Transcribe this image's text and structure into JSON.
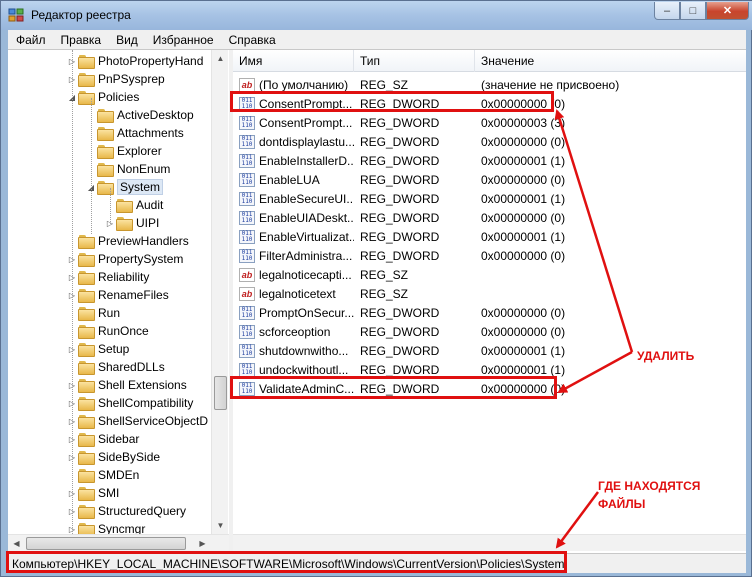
{
  "window": {
    "title": "Редактор реестра",
    "minimize_glyph": "–",
    "maximize_glyph": "□",
    "close_glyph": "✕"
  },
  "menu": [
    "Файл",
    "Правка",
    "Вид",
    "Избранное",
    "Справка"
  ],
  "tree": {
    "items": [
      {
        "label": "PhotoPropertyHand",
        "expander": "▷",
        "selected": false
      },
      {
        "label": "PnPSysprep",
        "expander": "▷",
        "selected": false
      },
      {
        "label": "Policies",
        "expander": "◢",
        "selected": false
      },
      {
        "label": "ActiveDesktop",
        "expander": "",
        "selected": false
      },
      {
        "label": "Attachments",
        "expander": "",
        "selected": false
      },
      {
        "label": "Explorer",
        "expander": "",
        "selected": false
      },
      {
        "label": "NonEnum",
        "expander": "",
        "selected": false
      },
      {
        "label": "System",
        "expander": "◢",
        "selected": true
      },
      {
        "label": "Audit",
        "expander": "",
        "selected": false
      },
      {
        "label": "UIPI",
        "expander": "▷",
        "selected": false
      },
      {
        "label": "PreviewHandlers",
        "expander": "",
        "selected": false
      },
      {
        "label": "PropertySystem",
        "expander": "▷",
        "selected": false
      },
      {
        "label": "Reliability",
        "expander": "▷",
        "selected": false
      },
      {
        "label": "RenameFiles",
        "expander": "▷",
        "selected": false
      },
      {
        "label": "Run",
        "expander": "",
        "selected": false
      },
      {
        "label": "RunOnce",
        "expander": "",
        "selected": false
      },
      {
        "label": "Setup",
        "expander": "▷",
        "selected": false
      },
      {
        "label": "SharedDLLs",
        "expander": "",
        "selected": false
      },
      {
        "label": "Shell Extensions",
        "expander": "▷",
        "selected": false
      },
      {
        "label": "ShellCompatibility",
        "expander": "▷",
        "selected": false
      },
      {
        "label": "ShellServiceObjectD",
        "expander": "▷",
        "selected": false
      },
      {
        "label": "Sidebar",
        "expander": "▷",
        "selected": false
      },
      {
        "label": "SideBySide",
        "expander": "▷",
        "selected": false
      },
      {
        "label": "SMDEn",
        "expander": "",
        "selected": false
      },
      {
        "label": "SMI",
        "expander": "▷",
        "selected": false
      },
      {
        "label": "StructuredQuery",
        "expander": "▷",
        "selected": false
      },
      {
        "label": "Syncmgr",
        "expander": "▷",
        "selected": false
      }
    ]
  },
  "list": {
    "columns": [
      "Имя",
      "Тип",
      "Значение"
    ],
    "rows": [
      {
        "name": "(По умолчанию)",
        "type": "REG_SZ",
        "value": "(значение не присвоено)",
        "icon": "string-icon"
      },
      {
        "name": "ConsentPrompt...",
        "type": "REG_DWORD",
        "value": "0x00000000 (0)",
        "icon": "dword-icon"
      },
      {
        "name": "ConsentPrompt...",
        "type": "REG_DWORD",
        "value": "0x00000003 (3)",
        "icon": "dword-icon"
      },
      {
        "name": "dontdisplaylastu...",
        "type": "REG_DWORD",
        "value": "0x00000000 (0)",
        "icon": "dword-icon"
      },
      {
        "name": "EnableInstallerD...",
        "type": "REG_DWORD",
        "value": "0x00000001 (1)",
        "icon": "dword-icon"
      },
      {
        "name": "EnableLUA",
        "type": "REG_DWORD",
        "value": "0x00000000 (0)",
        "icon": "dword-icon"
      },
      {
        "name": "EnableSecureUI...",
        "type": "REG_DWORD",
        "value": "0x00000001 (1)",
        "icon": "dword-icon"
      },
      {
        "name": "EnableUIADeskt...",
        "type": "REG_DWORD",
        "value": "0x00000000 (0)",
        "icon": "dword-icon"
      },
      {
        "name": "EnableVirtualizat...",
        "type": "REG_DWORD",
        "value": "0x00000001 (1)",
        "icon": "dword-icon"
      },
      {
        "name": "FilterAdministra...",
        "type": "REG_DWORD",
        "value": "0x00000000 (0)",
        "icon": "dword-icon"
      },
      {
        "name": "legalnoticecapti...",
        "type": "REG_SZ",
        "value": "",
        "icon": "string-icon"
      },
      {
        "name": "legalnoticetext",
        "type": "REG_SZ",
        "value": "",
        "icon": "string-icon"
      },
      {
        "name": "PromptOnSecur...",
        "type": "REG_DWORD",
        "value": "0x00000000 (0)",
        "icon": "dword-icon"
      },
      {
        "name": "scforceoption",
        "type": "REG_DWORD",
        "value": "0x00000000 (0)",
        "icon": "dword-icon"
      },
      {
        "name": "shutdownwitho...",
        "type": "REG_DWORD",
        "value": "0x00000001 (1)",
        "icon": "dword-icon"
      },
      {
        "name": "undockwithoutl...",
        "type": "REG_DWORD",
        "value": "0x00000001 (1)",
        "icon": "dword-icon"
      },
      {
        "name": "ValidateAdminC...",
        "type": "REG_DWORD",
        "value": "0x00000000 (0)",
        "icon": "dword-icon"
      }
    ]
  },
  "status": {
    "path": "Компьютер\\HKEY_LOCAL_MACHINE\\SOFTWARE\\Microsoft\\Windows\\CurrentVersion\\Policies\\System"
  },
  "annotations": {
    "delete_label": "УДАЛИТЬ",
    "location_label_line1": "ГДЕ НАХОДЯТСЯ",
    "location_label_line2": "ФАЙЛЫ",
    "color": "#e01010"
  },
  "icons": {
    "dword_glyph_top": "011",
    "dword_glyph_bottom": "110",
    "string_glyph": "ab",
    "scroll_up": "▲",
    "scroll_down": "▼",
    "scroll_left": "◀",
    "scroll_right": "▶"
  }
}
